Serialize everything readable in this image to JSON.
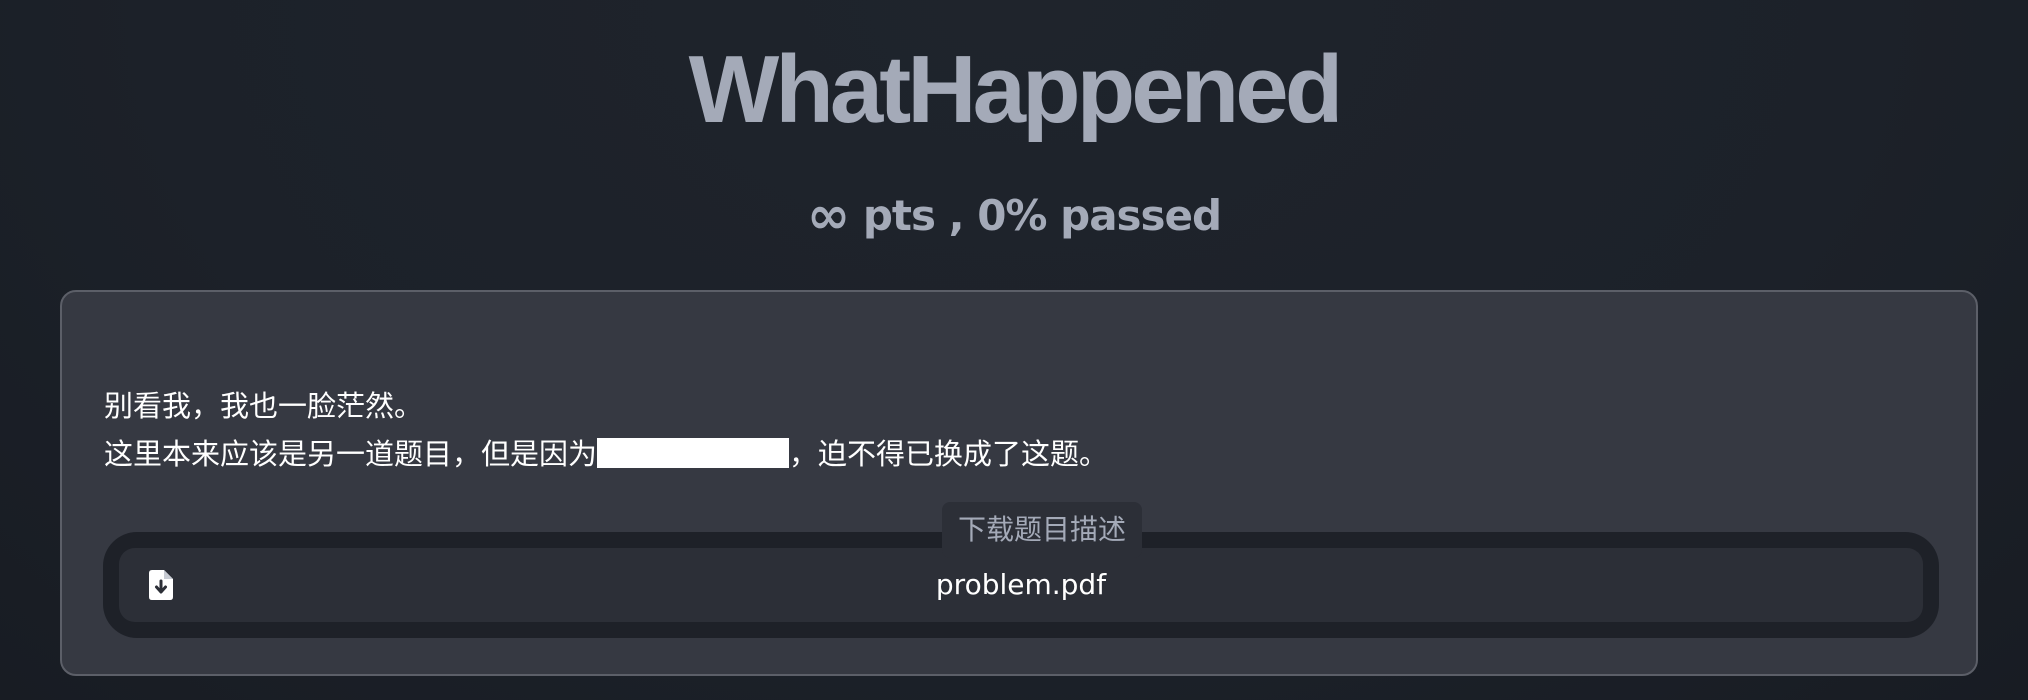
{
  "challenge": {
    "title": "WhatHappened",
    "points_symbol": "∞",
    "stats_suffix": " pts , 0% passed"
  },
  "description": {
    "line1": "别看我，我也一脸茫然。",
    "line2_before": "这里本来应该是另一道题目，但是因为",
    "line2_after": "，迫不得已换成了这题。"
  },
  "download": {
    "label": "下载题目描述",
    "file_name": "problem.pdf",
    "icon": "file-download-icon"
  },
  "colors": {
    "background": "#1c2129",
    "card": "#363942",
    "muted_text": "#a4aab8",
    "text": "#ffffff"
  }
}
